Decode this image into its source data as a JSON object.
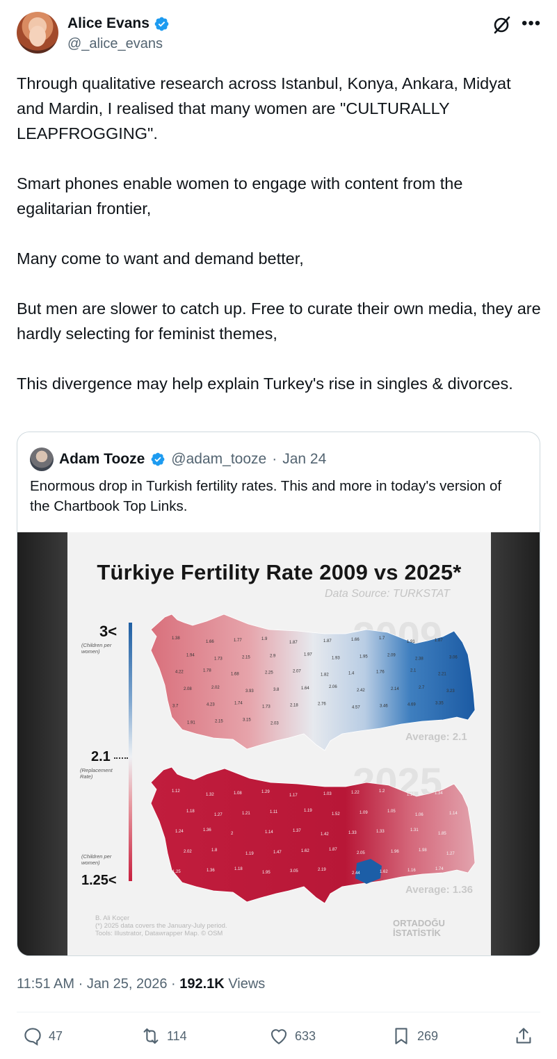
{
  "author": {
    "name": "Alice Evans",
    "handle": "@_alice_evans"
  },
  "tweet": {
    "paragraphs": [
      "Through qualitative research across Istanbul, Konya, Ankara, Midyat and Mardin, I realised that many women are \"CULTURALLY LEAPFROGGING\".",
      "Smart phones enable women to engage with content from the egalitarian frontier,",
      "Many come to want and demand better,",
      "But men are slower to catch up. Free to curate their own media, they are hardly selecting for feminist themes,",
      "This divergence may help explain Turkey's rise in singles & divorces."
    ]
  },
  "quote": {
    "name": "Adam Tooze",
    "handle": "@adam_tooze",
    "separator": "·",
    "date": "Jan 24",
    "text": "Enormous drop in Turkish fertility rates. This and more in today's version of the Chartbook Top Links."
  },
  "media": {
    "title": "Türkiye Fertility Rate 2009 vs 2025*",
    "source": "Data Source: TURKSTAT",
    "legend_top": "3<",
    "legend_top_note": "(Children per women)",
    "legend_mid": "2.1",
    "legend_mid_note": "(Replacement Rate)",
    "legend_bottom": "1.25<",
    "legend_bottom_note": "(Children per women)",
    "year_top": "2009",
    "year_bottom": "2025",
    "average_2009": "Average: 2.1",
    "average_2025": "Average: 1.36",
    "credit_author": "B. Ali Koçer",
    "credit_note": "(*) 2025 data covers the January-July period.",
    "credit_tools": "Tools: Illustrator, Datawrapper Map. © OSM",
    "brand_line1": "ORTADOĞU",
    "brand_line2": "İSTATİSTİK",
    "labels_2009": [
      "1.38",
      "1.66",
      "1.77",
      "1.9",
      "1.87",
      "1.87",
      "1.66",
      "1.7",
      "1.91",
      "1.87",
      "1.94",
      "1.73",
      "2.15",
      "2.9",
      "1.97",
      "1.93",
      "1.95",
      "2.09",
      "2.38",
      "3.06",
      "4.22",
      "1.78",
      "1.68",
      "2.25",
      "2.07",
      "1.82",
      "1.4",
      "1.76",
      "2.1",
      "2.21",
      "2.08",
      "2.02",
      "3.93",
      "3.8",
      "1.64",
      "2.06",
      "2.42",
      "2.14",
      "2.7",
      "3.23",
      "3.7",
      "4.23",
      "1.74",
      "1.73",
      "2.18",
      "2.76",
      "4.57",
      "3.46",
      "4.69",
      "3.35",
      "1.91",
      "2.15",
      "3.15",
      "2.03"
    ],
    "labels_2025": [
      "1.12",
      "1.32",
      "1.08",
      "1.29",
      "1.17",
      "1.03",
      "1.22",
      "1.2",
      "1.15",
      "1.34",
      "1.18",
      "1.27",
      "1.21",
      "1.11",
      "1.19",
      "1.52",
      "1.09",
      "1.05",
      "1.06",
      "1.14",
      "1.24",
      "1.36",
      "2",
      "1.14",
      "1.37",
      "1.42",
      "1.33",
      "1.33",
      "1.31",
      "1.85",
      "2.02",
      "1.8",
      "1.19",
      "1.47",
      "1.62",
      "1.87",
      "2.05",
      "1.96",
      "1.98",
      "1.27",
      "1.25",
      "1.36",
      "1.18",
      "1.95",
      "3.05",
      "2.19",
      "2.44",
      "1.62",
      "1.16",
      "1.74"
    ]
  },
  "meta": {
    "time": "11:51 AM",
    "date": "Jan 25, 2026",
    "views_count": "192.1K",
    "views_label": "Views"
  },
  "actions": {
    "replies": "47",
    "reposts": "114",
    "likes": "633",
    "bookmarks": "269"
  },
  "colors": {
    "accent": "#1d9bf0",
    "text": "#0f1419",
    "secondary": "#536471",
    "border": "#cfd9de"
  }
}
